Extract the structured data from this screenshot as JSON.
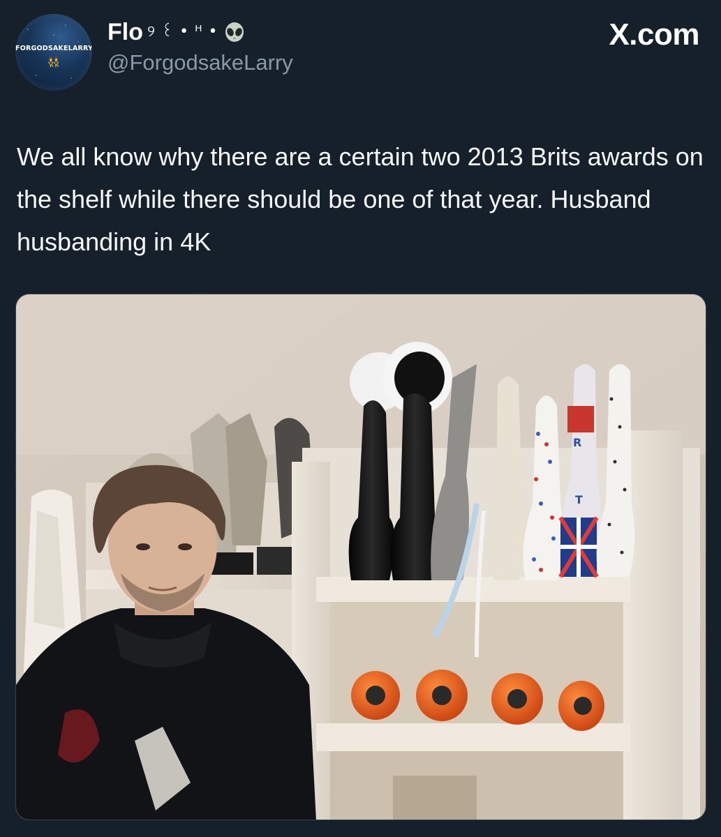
{
  "tweet": {
    "avatar": {
      "label": "FORGODSAKELARRY",
      "emoji": "👯"
    },
    "display_name": "Flo",
    "name_decoration": "୨ ꒰ • ᴴ •",
    "name_emoji": "alien-icon",
    "handle": "@ForgodsakeLarry",
    "site_label": "X.com",
    "text": "We all know why there are a certain two 2013 Brits awards on the shelf while there should be one of that year. Husband husbanding in 4K"
  },
  "colors": {
    "background": "#15202b",
    "text": "#f7f9f9",
    "secondary_text": "#8b98a5",
    "border": "#38444d"
  }
}
